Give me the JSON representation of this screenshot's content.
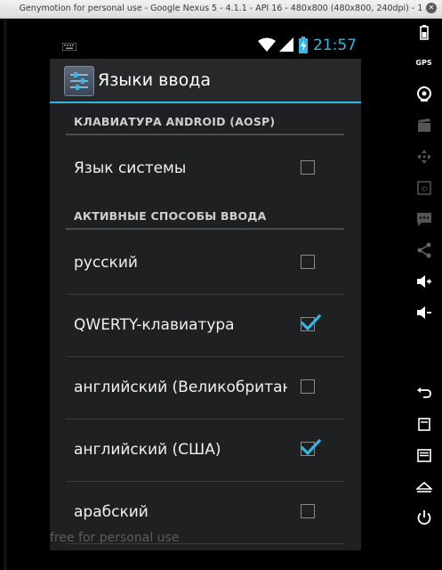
{
  "window": {
    "title": "Genymotion for personal use - Google Nexus 5 - 4.1.1 - API 16 - 480x800 (480x800, 240dpi) - 1",
    "close_glyph": "✕"
  },
  "statusbar": {
    "time": "21:57",
    "icons": [
      "keyboard-icon",
      "wifi-icon",
      "signal-icon",
      "battery-charging-icon"
    ],
    "accent_color": "#33b5e5"
  },
  "actionbar": {
    "title": "Языки ввода",
    "icon": "settings-app-icon"
  },
  "sections": [
    {
      "header": "КЛАВИАТУРА ANDROID (AOSP)",
      "items": [
        {
          "label": "Язык системы",
          "checked": false
        }
      ]
    },
    {
      "header": "АКТИВНЫЕ СПОСОБЫ ВВОДА",
      "items": [
        {
          "label": "русский",
          "checked": false
        },
        {
          "label": "QWERTY-клавиатура",
          "checked": true
        },
        {
          "label": "английский (Великобритания)",
          "checked": false
        },
        {
          "label": "английский (США)",
          "checked": true
        },
        {
          "label": "арабский",
          "checked": false
        }
      ]
    }
  ],
  "watermark": "free for personal use",
  "toolbar": {
    "gps_label": "GPS",
    "id_label": "ID",
    "items": [
      "battery-icon",
      "gps-icon",
      "camera-icon",
      "clapper-icon",
      "move-icon",
      "id-icon",
      "sms-icon",
      "share-icon",
      "volume-up-icon",
      "volume-down-icon",
      "back-icon",
      "home-icon",
      "menu-icon",
      "recent-apps-icon",
      "power-icon"
    ]
  }
}
